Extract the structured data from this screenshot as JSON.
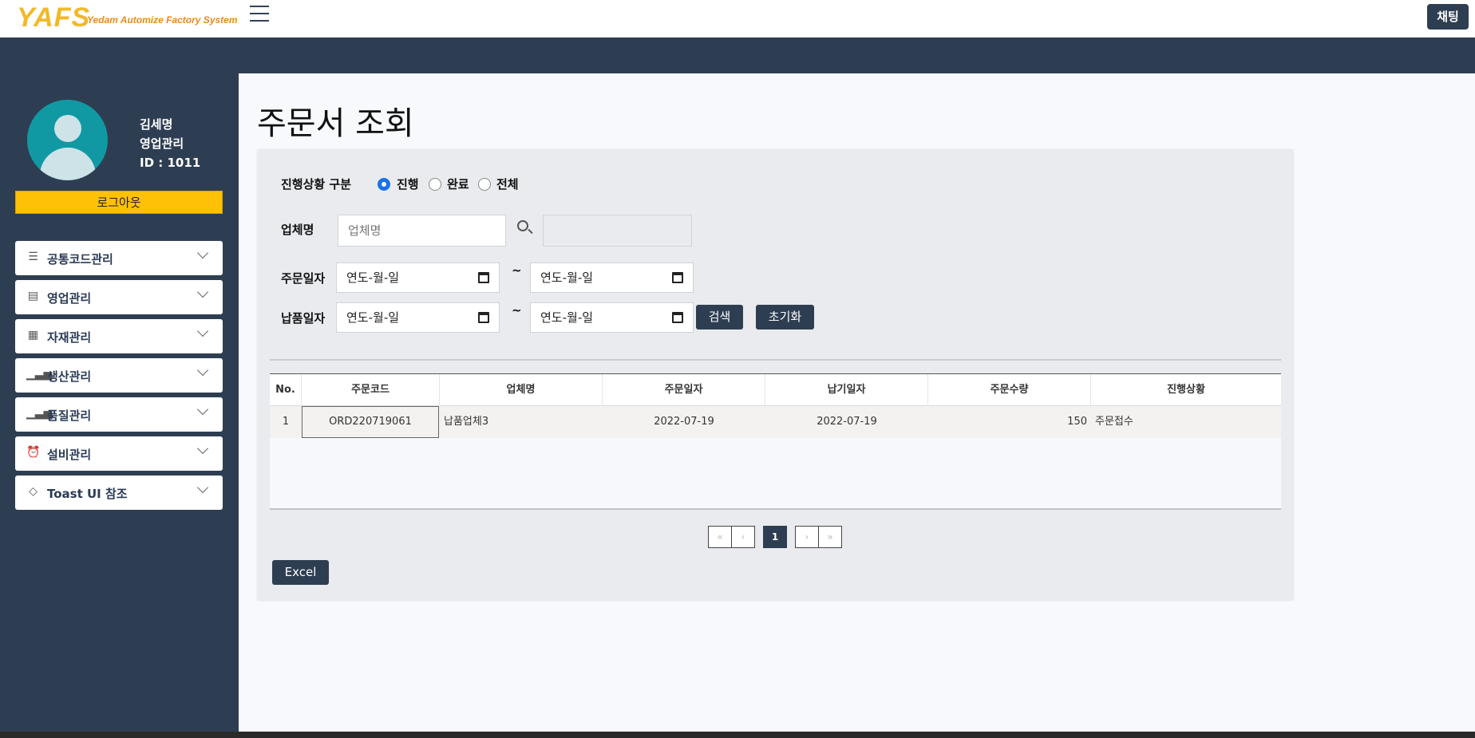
{
  "header": {
    "logo": "YAFS",
    "logo_sub": "Yedam Automize Factory System",
    "chat_label": "채팅"
  },
  "user": {
    "name": "김세명",
    "dept": "영업관리",
    "id_text": "ID : 1011",
    "logout_label": "로그아웃"
  },
  "sidebar": {
    "items": [
      {
        "label": "공통코드관리",
        "icon": "list-icon"
      },
      {
        "label": "영업관리",
        "icon": "document-icon"
      },
      {
        "label": "자재관리",
        "icon": "table-icon"
      },
      {
        "label": "생산관리",
        "icon": "bar-chart-icon"
      },
      {
        "label": "품질관리",
        "icon": "bar-chart-icon"
      },
      {
        "label": "설비관리",
        "icon": "alarm-clock-icon"
      },
      {
        "label": "Toast UI 참조",
        "icon": "diamond-icon"
      }
    ]
  },
  "main": {
    "title": "주문서 조회",
    "filters": {
      "status_label": "진행상황 구분",
      "status_options": [
        "진행",
        "완료",
        "전체"
      ],
      "status_selected": "진행",
      "vendor_label": "업체명",
      "vendor_placeholder": "업체명",
      "order_date_label": "주문일자",
      "delivery_date_label": "납품일자",
      "date_placeholder": "연도-월-일",
      "tilde": "~",
      "search_label": "검색",
      "reset_label": "초기화"
    },
    "table": {
      "columns": [
        "No.",
        "주문코드",
        "업체명",
        "주문일자",
        "납기일자",
        "주문수량",
        "진행상황"
      ],
      "rows": [
        {
          "no": "1",
          "code": "ORD220719061",
          "vendor": "납품업체3",
          "order_date": "2022-07-19",
          "due_date": "2022-07-19",
          "qty": "150",
          "status": "주문접수"
        }
      ]
    },
    "pagination": {
      "first": "«",
      "prev": "‹",
      "current": "1",
      "next": "›",
      "last": "»"
    },
    "excel_label": "Excel"
  }
}
